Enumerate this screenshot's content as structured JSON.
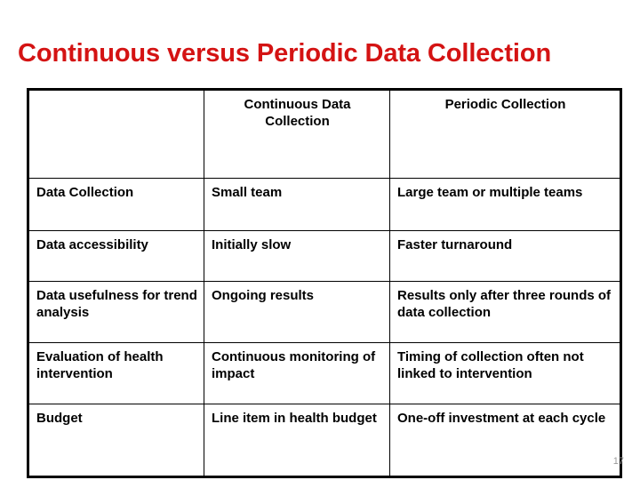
{
  "slide": {
    "title": "Continuous versus Periodic Data Collection",
    "page_number": "17",
    "accent_color": "#d41313",
    "text_color": "#000000",
    "border_color": "#000000",
    "background_color": "#ffffff"
  },
  "table": {
    "headers": {
      "corner": "",
      "continuous": "Continuous Data Collection",
      "periodic": "Periodic Collection"
    },
    "rows": [
      {
        "label": "Data Collection",
        "continuous": "Small team",
        "periodic": "Large team or multiple teams"
      },
      {
        "label": "Data accessibility",
        "continuous": "Initially slow",
        "periodic": "Faster turnaround"
      },
      {
        "label": "Data usefulness for trend analysis",
        "continuous": "Ongoing results",
        "periodic": "Results only after three rounds of data collection"
      },
      {
        "label": "Evaluation of health intervention",
        "continuous": "Continuous monitoring of impact",
        "periodic": "Timing of collection often not linked to intervention"
      },
      {
        "label": "Budget",
        "continuous": "Line item in health budget",
        "periodic": "One-off investment at each cycle"
      }
    ]
  }
}
